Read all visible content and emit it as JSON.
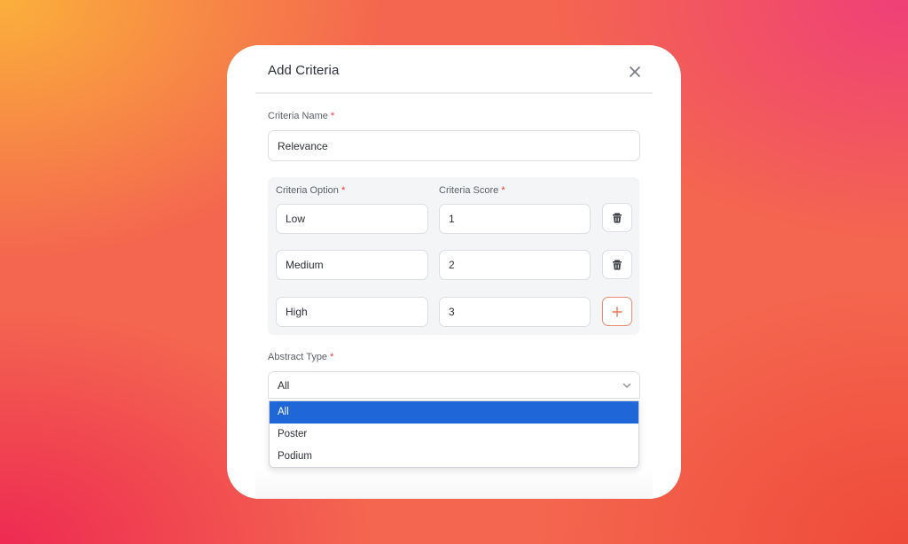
{
  "modal": {
    "title": "Add Criteria",
    "close_label": "×"
  },
  "criteria_name": {
    "label": "Criteria Name",
    "required_mark": "*",
    "value": "Relevance"
  },
  "options_table": {
    "option_header": "Criteria Option",
    "score_header": "Criteria Score",
    "required_mark": "*",
    "rows": [
      {
        "option": "Low",
        "score": "1",
        "action": "delete"
      },
      {
        "option": "Medium",
        "score": "2",
        "action": "delete"
      },
      {
        "option": "High",
        "score": "3",
        "action": "add"
      }
    ],
    "add_label": "+"
  },
  "abstract_type": {
    "label": "Abstract Type",
    "required_mark": "*",
    "selected": "All",
    "options": [
      "All",
      "Poster",
      "Podium"
    ],
    "highlighted_index": 0
  },
  "colors": {
    "accent_blue": "#1f66d8",
    "required_red": "#e53935",
    "add_orange": "#f0704f"
  }
}
